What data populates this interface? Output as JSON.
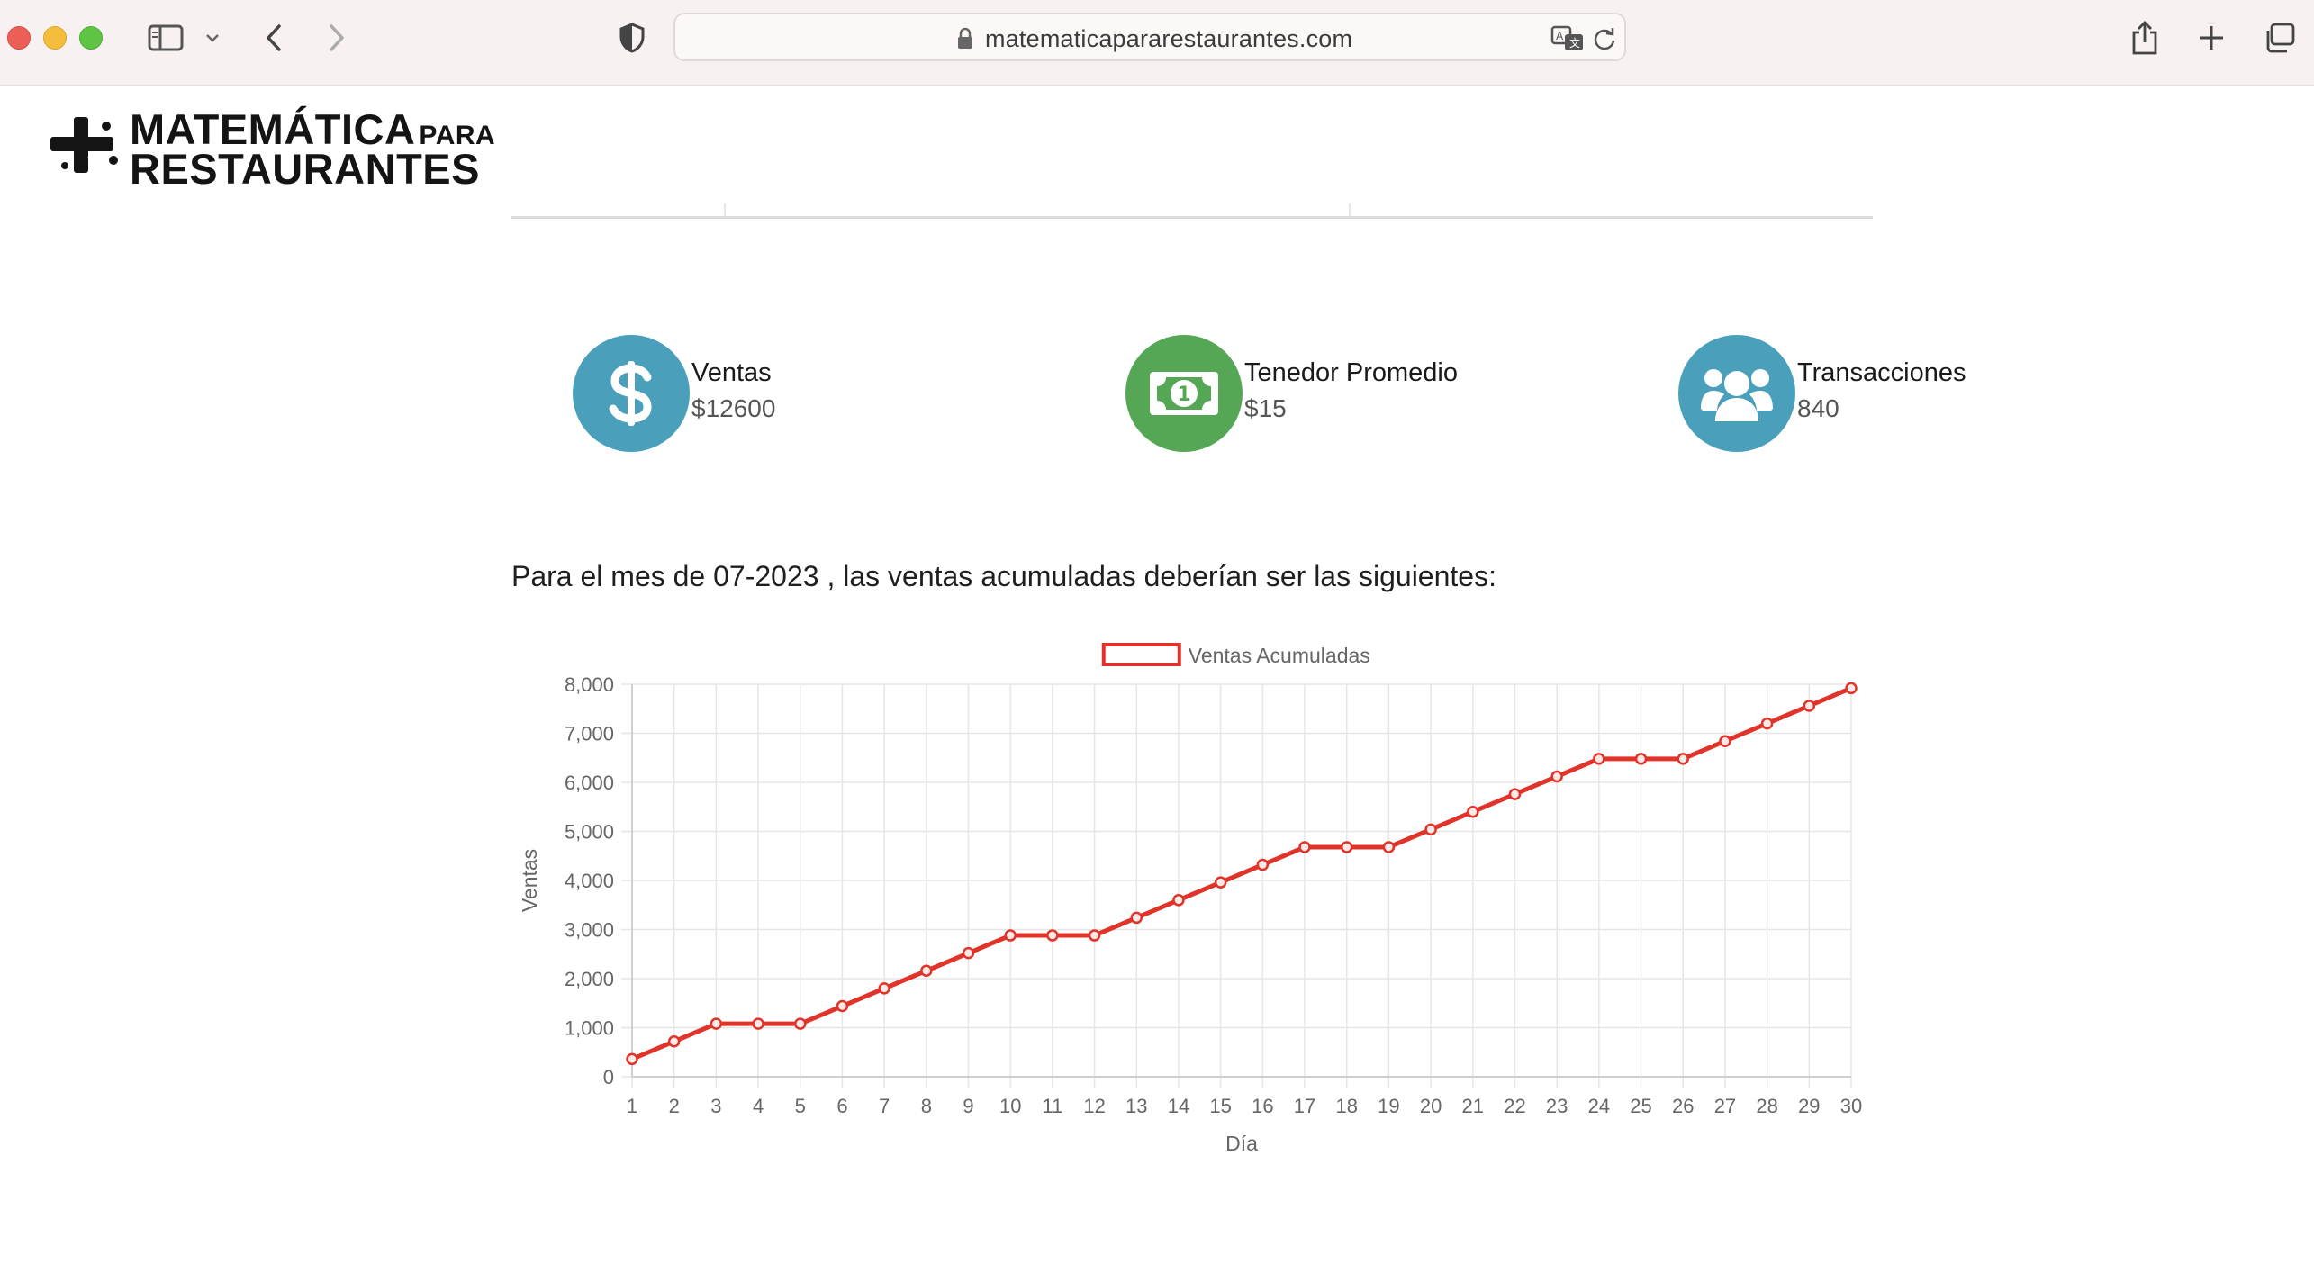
{
  "browser": {
    "url": "matematicapararestaurantes.com"
  },
  "logo": {
    "line1": "MATEMÁTICA",
    "line1_small": "PARA",
    "line2": "RESTAURANTES"
  },
  "stats": [
    {
      "label": "Ventas",
      "value": "$12600",
      "icon": "dollar-icon",
      "color": "#4aa0bb"
    },
    {
      "label": "Tenedor Promedio",
      "value": "$15",
      "icon": "banknote-icon",
      "color": "#55a755"
    },
    {
      "label": "Transacciones",
      "value": "840",
      "icon": "users-icon",
      "color": "#4aa0bb"
    }
  ],
  "intro_text": "Para el mes de 07-2023 , las ventas acumuladas deberían ser las siguientes:",
  "colors": {
    "line": "#e0342a",
    "grid": "#e6e6e6",
    "axis_text": "#666666"
  },
  "chart_data": {
    "type": "line",
    "legend": "Ventas Acumuladas",
    "legend_position": "top",
    "xlabel": "Día",
    "ylabel": "Ventas",
    "ylim": [
      0,
      8000
    ],
    "yticks": [
      0,
      1000,
      2000,
      3000,
      4000,
      5000,
      6000,
      7000,
      8000
    ],
    "ytick_labels": [
      "0",
      "1,000",
      "2,000",
      "3,000",
      "4,000",
      "5,000",
      "6,000",
      "7,000",
      "8,000"
    ],
    "grid": true,
    "x": [
      "1",
      "2",
      "3",
      "4",
      "5",
      "6",
      "7",
      "8",
      "9",
      "10",
      "11",
      "12",
      "13",
      "14",
      "15",
      "16",
      "17",
      "18",
      "19",
      "20",
      "21",
      "22",
      "23",
      "24",
      "25",
      "26",
      "27",
      "28",
      "29",
      "30"
    ],
    "series": [
      {
        "name": "Ventas Acumuladas",
        "values": [
          360,
          720,
          1080,
          1080,
          1080,
          1440,
          1800,
          2160,
          2520,
          2880,
          2880,
          2880,
          3240,
          3600,
          3960,
          4320,
          4680,
          4680,
          4680,
          5040,
          5400,
          5760,
          6120,
          6480,
          6480,
          6480,
          6840,
          7200,
          7560,
          7920
        ]
      }
    ]
  }
}
